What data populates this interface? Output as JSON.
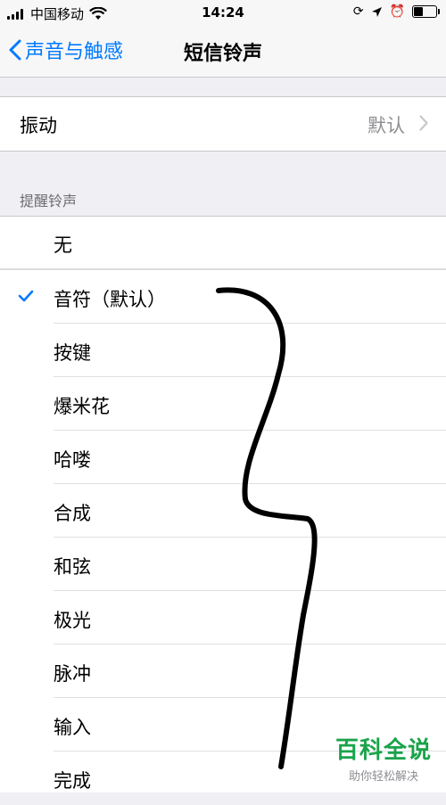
{
  "status": {
    "carrier": "中国移动",
    "time": "14:24",
    "icons": [
      "signal-icon",
      "wifi-icon",
      "rotation-lock-icon",
      "location-icon",
      "alarm-icon",
      "battery-icon"
    ]
  },
  "nav": {
    "back_label": "声音与触感",
    "title": "短信铃声"
  },
  "vibration": {
    "label": "振动",
    "value": "默认"
  },
  "alert_tones": {
    "header": "提醒铃声",
    "none_label": "无",
    "items": [
      "音符（默认）",
      "按键",
      "爆米花",
      "哈喽",
      "合成",
      "和弦",
      "极光",
      "脉冲",
      "输入",
      "完成"
    ],
    "selected": "音符（默认）"
  },
  "watermark": {
    "title": "百科全说",
    "subtitle": "助你轻松解决"
  },
  "colors": {
    "accent": "#007aff",
    "watermark_green": "#1aa34a",
    "background": "#efeff4"
  }
}
